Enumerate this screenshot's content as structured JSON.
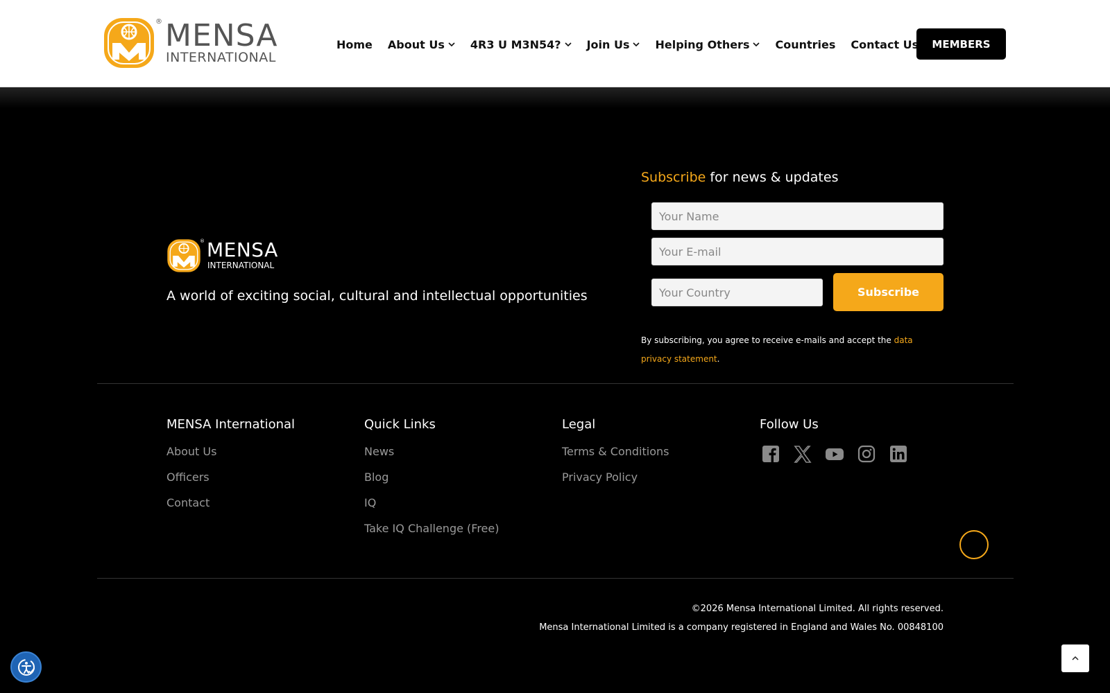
{
  "header": {
    "logo": {
      "word1": "MENSA",
      "word2": "INTERNATIONAL",
      "reg": "®"
    },
    "nav": [
      {
        "label": "Home",
        "dropdown": false
      },
      {
        "label": "About Us",
        "dropdown": true
      },
      {
        "label": "4R3 U M3N54?",
        "dropdown": true
      },
      {
        "label": "Join Us",
        "dropdown": true
      },
      {
        "label": "Helping Others",
        "dropdown": true
      },
      {
        "label": "Countries",
        "dropdown": false
      },
      {
        "label": "Contact Us",
        "dropdown": false
      }
    ],
    "members_label": "MEMBERS"
  },
  "footer": {
    "logo": {
      "word1": "MENSA",
      "word2": "INTERNATIONAL",
      "reg": "®"
    },
    "tagline": "A world of exciting social, cultural and intellectual opportunities",
    "subscribe": {
      "title_accent": "Subscribe",
      "title_rest": " for news & updates",
      "name_placeholder": "Your Name",
      "email_placeholder": "Your E-mail",
      "country_placeholder": "Your Country",
      "button_label": "Subscribe",
      "consent_text": "By subscribing, you agree to receive e-mails and accept the ",
      "consent_link": "data privacy statement",
      "consent_end": "."
    },
    "columns": {
      "mensa": {
        "title": "MENSA International",
        "links": [
          "About Us",
          "Officers",
          "Contact"
        ]
      },
      "quick": {
        "title": "Quick Links",
        "links": [
          "News",
          "Blog",
          "IQ",
          "Take IQ Challenge (Free)"
        ]
      },
      "legal": {
        "title": "Legal",
        "links": [
          "Terms & Conditions",
          "Privacy Policy"
        ]
      },
      "follow": {
        "title": "Follow Us",
        "icons": [
          "facebook-icon",
          "x-twitter-icon",
          "youtube-icon",
          "instagram-icon",
          "linkedin-icon"
        ]
      }
    },
    "copyright": "©2026 Mensa International Limited. All rights reserved.",
    "company": "Mensa International Limited is a company registered in England and Wales No. 00848100"
  },
  "colors": {
    "accent": "#f5a81a",
    "background": "#000000",
    "link": "#9a9a9a",
    "accessibility": "#1f64b4"
  }
}
